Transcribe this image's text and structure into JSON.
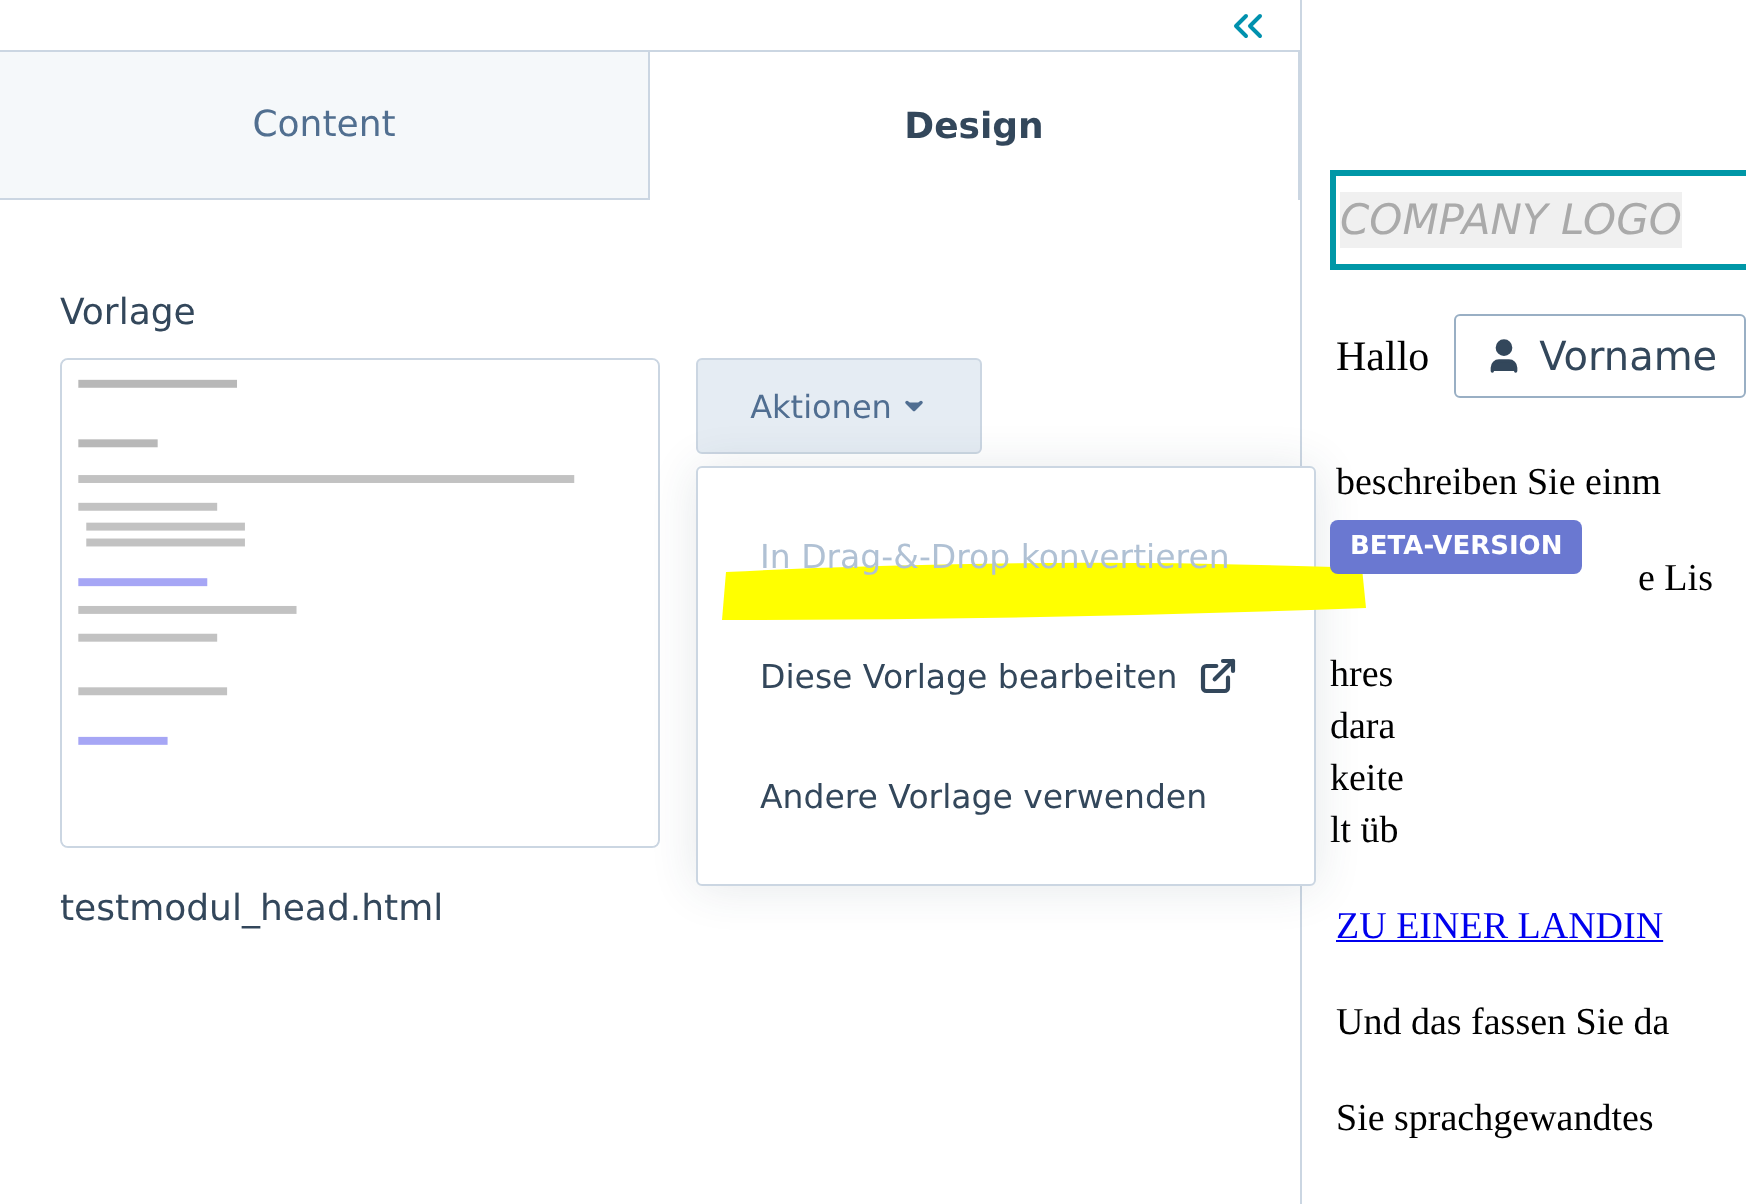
{
  "tabs": [
    {
      "label": "Content",
      "selected": false
    },
    {
      "label": "Design",
      "selected": true
    }
  ],
  "section": {
    "title": "Vorlage",
    "filename": "testmodul_head.html"
  },
  "actions": {
    "label": "Aktionen",
    "expanded": true,
    "menu": [
      {
        "label": "In Drag-&-Drop konvertieren",
        "disabled": true,
        "highlighted": true,
        "badge": "BETA-VERSION",
        "external": false
      },
      {
        "label": "Diese Vorlage bearbeiten",
        "disabled": false,
        "highlighted": false,
        "external": true
      },
      {
        "label": "Andere Vorlage verwenden",
        "disabled": false,
        "highlighted": false,
        "external": false
      }
    ]
  },
  "preview": {
    "logo": "COMPANY LOGO",
    "greeting": "Hallo",
    "token": "Vorname",
    "paragraphs": [
      {
        "kind": "text",
        "lines": [
          "beschreiben Sie einm"
        ]
      },
      {
        "kind": "badge_covered",
        "lines": [
          "e Lis"
        ]
      },
      {
        "kind": "covered",
        "lines": [
          "hres",
          "dara",
          "keite",
          "lt üb"
        ]
      },
      {
        "kind": "link",
        "lines": [
          "ZU EINER LANDIN"
        ]
      },
      {
        "kind": "text",
        "lines": [
          "Und das fassen Sie da"
        ]
      },
      {
        "kind": "text",
        "lines": [
          "Sie sprachgewandtes"
        ]
      }
    ]
  }
}
